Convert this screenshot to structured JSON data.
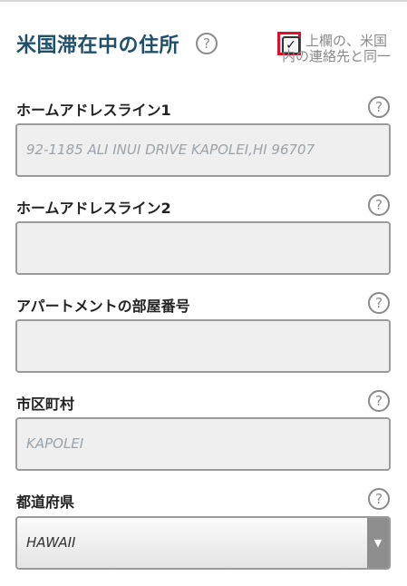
{
  "section": {
    "title": "米国滞在中の住所",
    "help_icon": "?",
    "same_as_contact_label": "上欄の、米国内の連絡先と同一",
    "same_as_contact_checked": true
  },
  "fields": {
    "address1": {
      "label": "ホームアドレスライン1",
      "help_icon": "?",
      "value": "92-1185 ALI INUI DRIVE KAPOLEI,HI 96707"
    },
    "address2": {
      "label": "ホームアドレスライン2",
      "help_icon": "?",
      "value": ""
    },
    "apartment": {
      "label": "アパートメントの部屋番号",
      "help_icon": "?",
      "value": ""
    },
    "city": {
      "label": "市区町村",
      "help_icon": "?",
      "value": "KAPOLEI"
    },
    "state": {
      "label": "都道府県",
      "help_icon": "?",
      "selected": "HAWAII",
      "arrow": "▼"
    }
  },
  "colors": {
    "title": "#1f4f6b",
    "highlight": "#e0102a"
  }
}
